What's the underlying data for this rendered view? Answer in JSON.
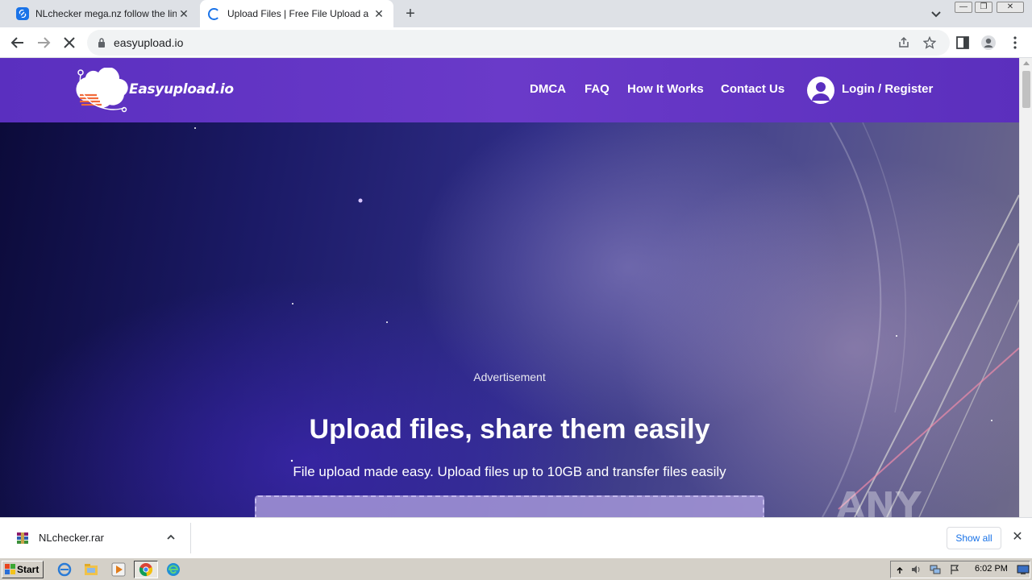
{
  "browser": {
    "tabs": [
      {
        "title": "NLchecker mega.nz follow the link —",
        "active": false
      },
      {
        "title": "Upload Files | Free File Upload and T",
        "active": true
      }
    ],
    "url": "easyupload.io"
  },
  "site": {
    "logo_text": "Easyupload.io",
    "nav": [
      "DMCA",
      "FAQ",
      "How It Works",
      "Contact Us"
    ],
    "login_label": "Login / Register",
    "advertisement": "Advertisement",
    "headline": "Upload files, share them easily",
    "subline": "File upload made easy. Upload files up to 10GB and transfer files easily",
    "accent_color": "#5b30bf"
  },
  "downloads": {
    "file_name": "NLchecker.rar",
    "show_all": "Show all"
  },
  "taskbar": {
    "start_label": "Start",
    "clock": "6:02 PM"
  },
  "watermark": "ANY RUN"
}
